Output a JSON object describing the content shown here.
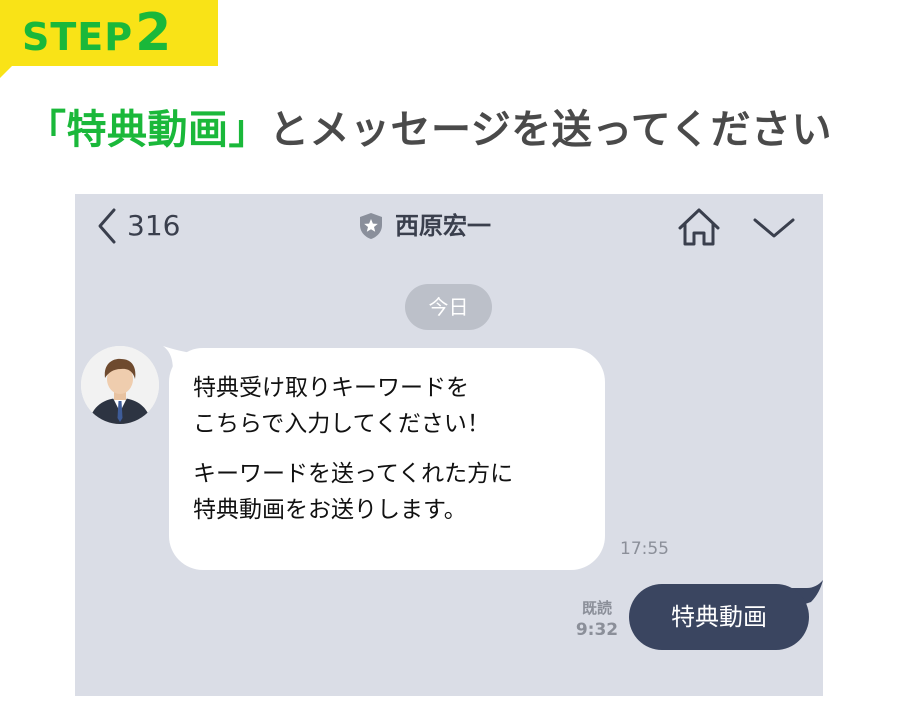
{
  "step": {
    "word": "STEP",
    "number": "2"
  },
  "heading": {
    "highlight": "「特典動画」",
    "rest": "とメッセージを送ってください"
  },
  "chat": {
    "header": {
      "back_count": "316",
      "name": "西原宏一",
      "back_icon": "chevron-left-icon",
      "official_icon": "shield-star-icon",
      "home_icon": "home-icon",
      "menu_icon": "chevron-down-icon"
    },
    "date_label": "今日",
    "incoming": {
      "lines_1": [
        "特典受け取りキーワードを",
        "こちらで入力してください！"
      ],
      "lines_2": [
        "キーワードを送ってくれた方に",
        "特典動画をお送りします。"
      ],
      "time": "17:55"
    },
    "outgoing": {
      "text": "特典動画",
      "read_label": "既読",
      "time": "9:32"
    }
  },
  "colors": {
    "brand_green": "#1ab83a",
    "badge_yellow": "#f9e317",
    "heading_gray": "#4a4a4a",
    "chat_background": "#dadde6",
    "outgoing_bubble": "#3a4560",
    "date_pill": "#bcc0c9"
  }
}
